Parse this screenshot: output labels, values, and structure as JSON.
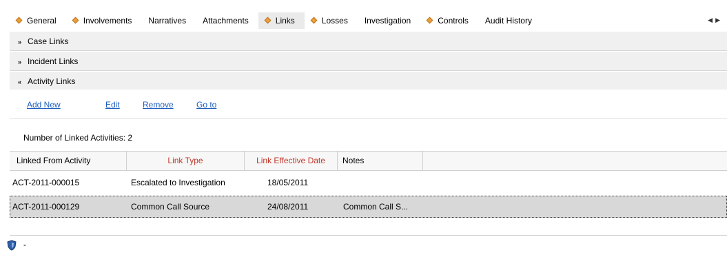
{
  "tabs": [
    {
      "label": "General",
      "flagged": true
    },
    {
      "label": "Involvements",
      "flagged": true
    },
    {
      "label": "Narratives",
      "flagged": false
    },
    {
      "label": "Attachments",
      "flagged": false
    },
    {
      "label": "Links",
      "flagged": true,
      "active": true
    },
    {
      "label": "Losses",
      "flagged": true
    },
    {
      "label": "Investigation",
      "flagged": false
    },
    {
      "label": "Controls",
      "flagged": true
    },
    {
      "label": "Audit History",
      "flagged": false
    }
  ],
  "sections": {
    "case_links": "Case Links",
    "incident_links": "Incident Links",
    "activity_links": "Activity Links"
  },
  "actions": {
    "add_new": "Add New",
    "edit": "Edit",
    "remove": "Remove",
    "go_to": "Go to"
  },
  "count_label": "Number of Linked Activities: 2",
  "grid": {
    "headers": [
      "Linked From Activity",
      "Link Type",
      "Link Effective Date",
      "Notes"
    ],
    "rows": [
      {
        "activity": "ACT-2011-000015",
        "link_type": "Escalated to Investigation",
        "date": "18/05/2011",
        "notes": ""
      },
      {
        "activity": "ACT-2011-000129",
        "link_type": "Common Call Source",
        "date": "24/08/2011",
        "notes": "Common Call S..."
      }
    ]
  },
  "footer": {
    "text": "-",
    "icon": "shield-icon"
  },
  "colors": {
    "accent_link": "#1f5fbf",
    "required_header": "#c0392b",
    "flag": "#e8a23a"
  }
}
